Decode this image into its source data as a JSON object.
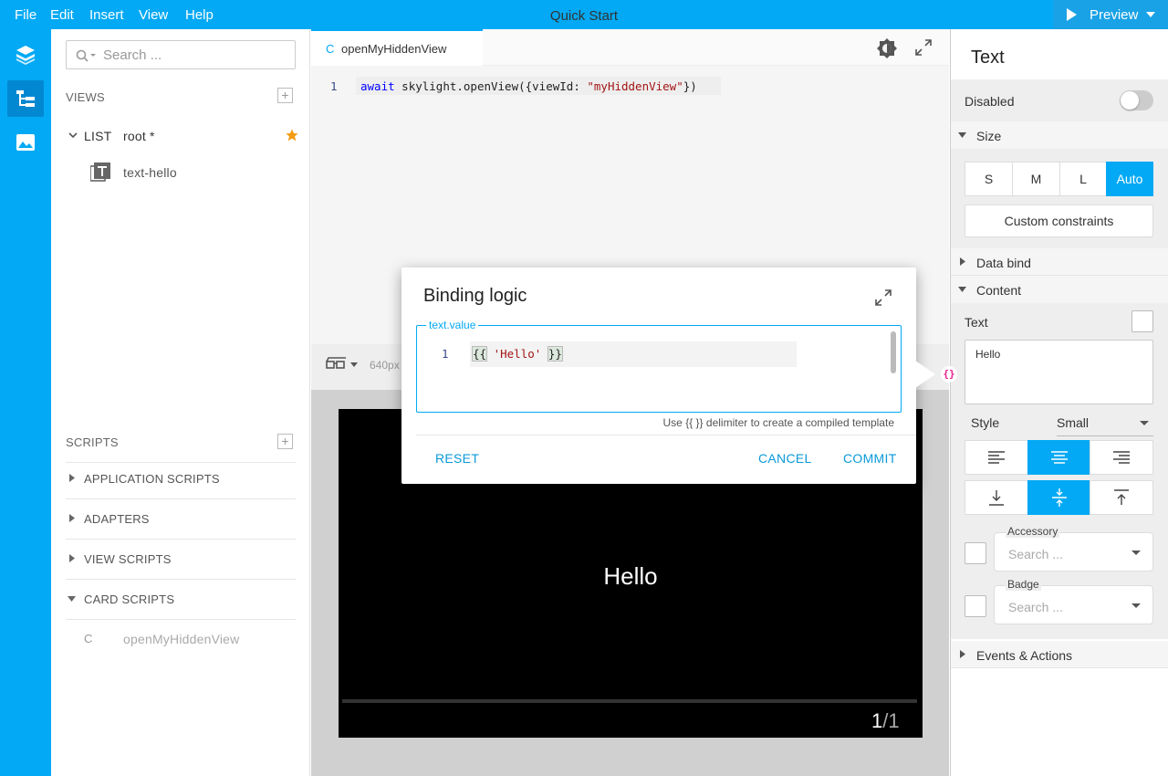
{
  "menu": {
    "file": "File",
    "edit": "Edit",
    "insert": "Insert",
    "view": "View",
    "help": "Help"
  },
  "app": {
    "title": "Quick Start"
  },
  "preview_button": {
    "label": "Preview"
  },
  "left": {
    "search_placeholder": "Search ...",
    "views_title": "VIEWS",
    "list_type": "LIST",
    "list_name": "root *",
    "child_item": "text-hello",
    "scripts_title": "SCRIPTS",
    "script_groups": [
      "APPLICATION SCRIPTS",
      "ADAPTERS",
      "VIEW SCRIPTS",
      "CARD SCRIPTS"
    ],
    "card_script_prefix": "C",
    "card_script_name": "openMyHiddenView"
  },
  "editor": {
    "tab_prefix": "C",
    "tab_label": "openMyHiddenView",
    "line_number": "1",
    "code_keyword": "await",
    "code_call": "skylight.openView({viewId: ",
    "code_string": "\"myHiddenView\"",
    "code_end": "})"
  },
  "preview": {
    "width_label": "640px",
    "screen_text": "Hello",
    "page_current": "1",
    "page_sep": "/1"
  },
  "dialog": {
    "title": "Binding logic",
    "field_legend": "text.value",
    "line_number": "1",
    "code_open": "{{",
    "code_string": "'Hello'",
    "code_close": "}}",
    "hint": "Use {{ }} delimiter to create a compiled template",
    "reset": "RESET",
    "cancel": "CANCEL",
    "commit": "COMMIT"
  },
  "right": {
    "title": "Text",
    "disabled_label": "Disabled",
    "size_title": "Size",
    "sizes": [
      "S",
      "M",
      "L",
      "Auto"
    ],
    "selected_size": "Auto",
    "custom_constraints": "Custom constraints",
    "data_bind": "Data bind",
    "content": "Content",
    "text_label": "Text",
    "text_value": "Hello",
    "style_label": "Style",
    "style_value": "Small",
    "accessory_label": "Accessory",
    "accessory_placeholder": "Search ...",
    "badge_label": "Badge",
    "badge_placeholder": "Search ...",
    "events_actions": "Events & Actions"
  },
  "colors": {
    "accent": "#03a9f4",
    "star": "#f39c12",
    "code_string": "#a31515",
    "code_keyword": "#0000ff",
    "binding_icon": "#e91e8c"
  }
}
